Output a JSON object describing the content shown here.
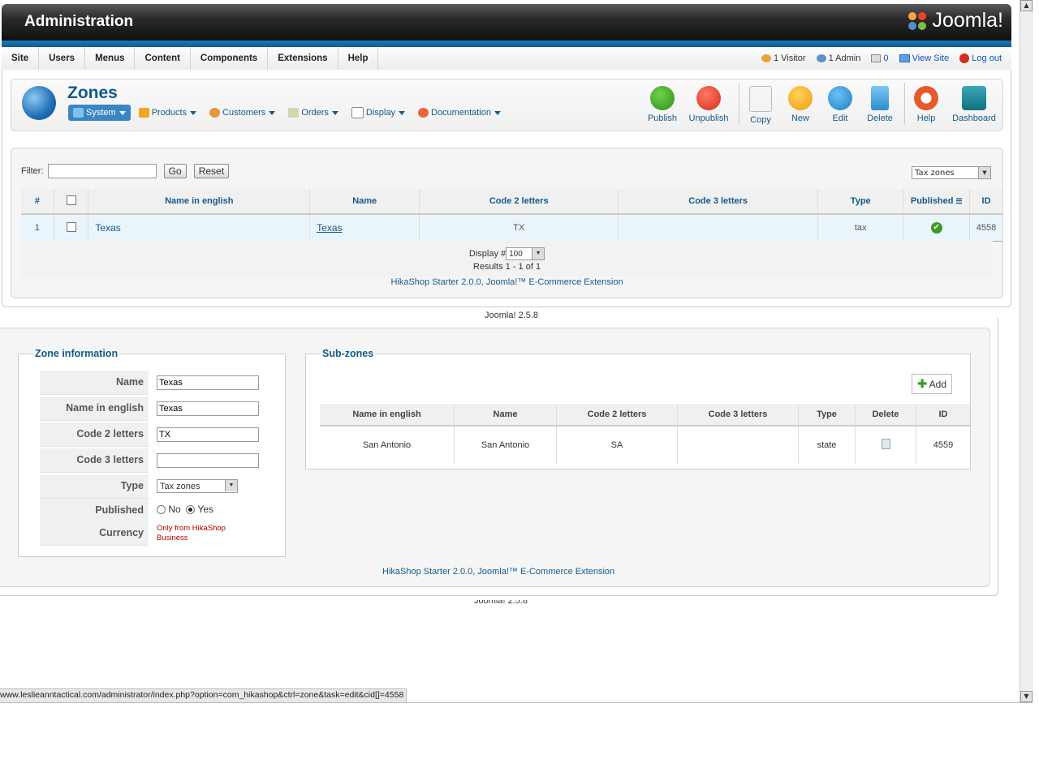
{
  "header": {
    "title": "Administration",
    "logo_text": "Joomla!"
  },
  "menu": [
    "Site",
    "Users",
    "Menus",
    "Content",
    "Components",
    "Extensions",
    "Help"
  ],
  "status": {
    "visitors": "1 Visitor",
    "admins": "1 Admin",
    "messages": "0",
    "view_site": "View Site",
    "logout": "Log out"
  },
  "page": {
    "title": "Zones",
    "submenu": [
      "System",
      "Products",
      "Customers",
      "Orders",
      "Display",
      "Documentation"
    ],
    "toolbar": [
      "Publish",
      "Unpublish",
      "Copy",
      "New",
      "Edit",
      "Delete",
      "Help",
      "Dashboard"
    ]
  },
  "list": {
    "filter_label": "Filter:",
    "filter_value": "",
    "go": "Go",
    "reset": "Reset",
    "type_select": "Tax zones",
    "columns": [
      "#",
      "",
      "Name in english",
      "Name",
      "Code 2 letters",
      "Code 3 letters",
      "Type",
      "Published",
      "ID"
    ],
    "rows": [
      {
        "num": "1",
        "name_en": "Texas",
        "name": "Texas",
        "code2": "TX",
        "code3": "",
        "type": "tax",
        "id": "4558"
      }
    ],
    "display_label": "Display #",
    "display_value": "100",
    "results": "Results 1 - 1 of 1",
    "credit": "HikaShop Starter 2.0.0, Joomla!™ E-Commerce Extension",
    "version": "Joomla! 2.5.8"
  },
  "zone_info": {
    "legend": "Zone information",
    "fields": {
      "name_label": "Name",
      "name_value": "Texas",
      "name_en_label": "Name in english",
      "name_en_value": "Texas",
      "code2_label": "Code 2 letters",
      "code2_value": "TX",
      "code3_label": "Code 3 letters",
      "code3_value": "",
      "type_label": "Type",
      "type_value": "Tax zones",
      "published_label": "Published",
      "no": "No",
      "yes": "Yes",
      "currency_label": "Currency",
      "currency_note": "Only from HikaShop Business"
    }
  },
  "subzones": {
    "legend": "Sub-zones",
    "add": "Add",
    "columns": [
      "Name in english",
      "Name",
      "Code 2 letters",
      "Code 3 letters",
      "Type",
      "Delete",
      "ID"
    ],
    "rows": [
      {
        "name_en": "San Antonio",
        "name": "San Antonio",
        "code2": "SA",
        "code3": "",
        "type": "state",
        "id": "4559"
      }
    ]
  },
  "edit_credit": "HikaShop Starter 2.0.0, Joomla!™ E-Commerce Extension",
  "status_url": "www.leslieanntactical.com/administrator/index.php?option=com_hikashop&ctrl=zone&task=edit&cid[]=4558",
  "colors": {
    "brand_blue": "#135a8b",
    "header_dark": "#111111",
    "accent_bar": "#1c7ab8"
  }
}
